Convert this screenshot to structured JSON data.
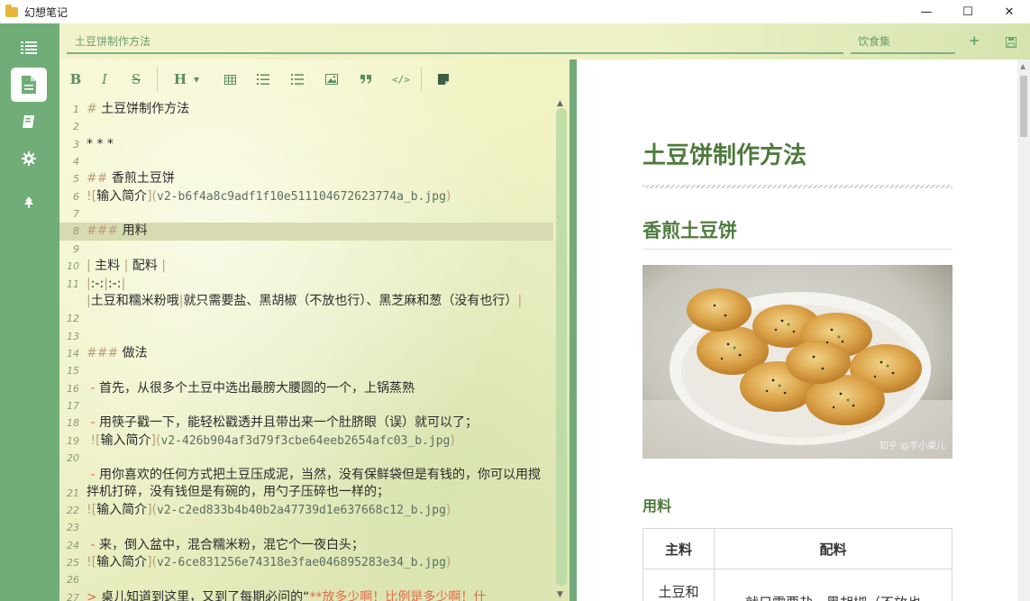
{
  "window": {
    "title": "幻想笔记",
    "minimize": "—",
    "maximize": "☐",
    "close": "✕"
  },
  "sidebar": {
    "items": [
      {
        "name": "notes-list",
        "icon": "list-icon"
      },
      {
        "name": "document",
        "icon": "document-icon",
        "active": true
      },
      {
        "name": "notebooks",
        "icon": "book-icon"
      },
      {
        "name": "settings",
        "icon": "gear-icon"
      },
      {
        "name": "tree",
        "icon": "tree-icon"
      }
    ]
  },
  "header": {
    "note_title": "土豆饼制作方法",
    "notebook": "饮食集",
    "add_icon": "plus-icon",
    "save_icon": "save-icon"
  },
  "toolbar": {
    "bold": "B",
    "italic": "I",
    "strike": "S",
    "heading": "H",
    "heading_caret": "▾",
    "icons": [
      "table-icon",
      "ordered-list-icon",
      "unordered-list-icon",
      "image-icon",
      "quote-icon",
      "code-icon",
      "note-icon"
    ]
  },
  "editor": {
    "lines": [
      {
        "n": "1",
        "t": "# 土豆饼制作方法"
      },
      {
        "n": "2",
        "t": ""
      },
      {
        "n": "3",
        "t": "* * *"
      },
      {
        "n": "4",
        "t": ""
      },
      {
        "n": "5",
        "t": "## 香煎土豆饼"
      },
      {
        "n": "6",
        "t": "![输入简介](v2-b6f4a8c9adf1f10e511104672623774a_b.jpg)"
      },
      {
        "n": "7",
        "t": ""
      },
      {
        "n": "8",
        "t": "### 用料"
      },
      {
        "n": "9",
        "t": ""
      },
      {
        "n": "10",
        "t": "| 主料 | 配料 |"
      },
      {
        "n": "11",
        "t": "|:-:|:-:|"
      },
      {
        "n": "12",
        "t": "|土豆和糯米粉哦|就只需要盐、黑胡椒（不放也行）、黑芝麻和葱（没有也行）|"
      },
      {
        "n": "13",
        "t": ""
      },
      {
        "n": "14",
        "t": "### 做法"
      },
      {
        "n": "15",
        "t": ""
      },
      {
        "n": "16",
        "t": " - 首先，从很多个土豆中选出最膀大腰圆的一个，上锅蒸熟"
      },
      {
        "n": "17",
        "t": ""
      },
      {
        "n": "18",
        "t": " - 用筷子戳一下，能轻松戳透并且带出来一个肚脐眼（误）就可以了；"
      },
      {
        "n": "19",
        "t": " ![输入简介](v2-426b904af3d79f3cbe64eeb2654afc03_b.jpg)"
      },
      {
        "n": "20",
        "t": ""
      },
      {
        "n": "21",
        "t": " - 用你喜欢的任何方式把土豆压成泥，当然，没有保鲜袋但是有钱的，你可以用搅拌机打碎，没有钱但是有碗的，用勺子压碎也一样的；"
      },
      {
        "n": "22",
        "t": "![输入简介](v2-c2ed833b4b40b2a47739d1e637668c12_b.jpg)"
      },
      {
        "n": "23",
        "t": ""
      },
      {
        "n": "24",
        "t": " - 来，倒入盆中，混合糯米粉，混它个一夜白头；"
      },
      {
        "n": "25",
        "t": "![输入简介](v2-6ce831256e74318e3fae046895283e34_b.jpg)"
      },
      {
        "n": "26",
        "t": ""
      },
      {
        "n": "27",
        "t": "> 桌儿知道到这里，又到了每期必问的“**放多少啊！比例是多少啊！什"
      }
    ]
  },
  "preview": {
    "h1": "土豆饼制作方法",
    "h2": "香煎土豆饼",
    "image_watermark": "知乎 @芋小桌儿",
    "h3": "用料",
    "table": {
      "headers": [
        "主料",
        "配料"
      ],
      "row": [
        "土豆和",
        "就只需要盐、黑胡椒（不放也"
      ]
    }
  },
  "colors": {
    "accent": "#70ad78",
    "heading": "#4f7a3e",
    "markup": "#b9a07a",
    "list_marker": "#e06a4b"
  }
}
